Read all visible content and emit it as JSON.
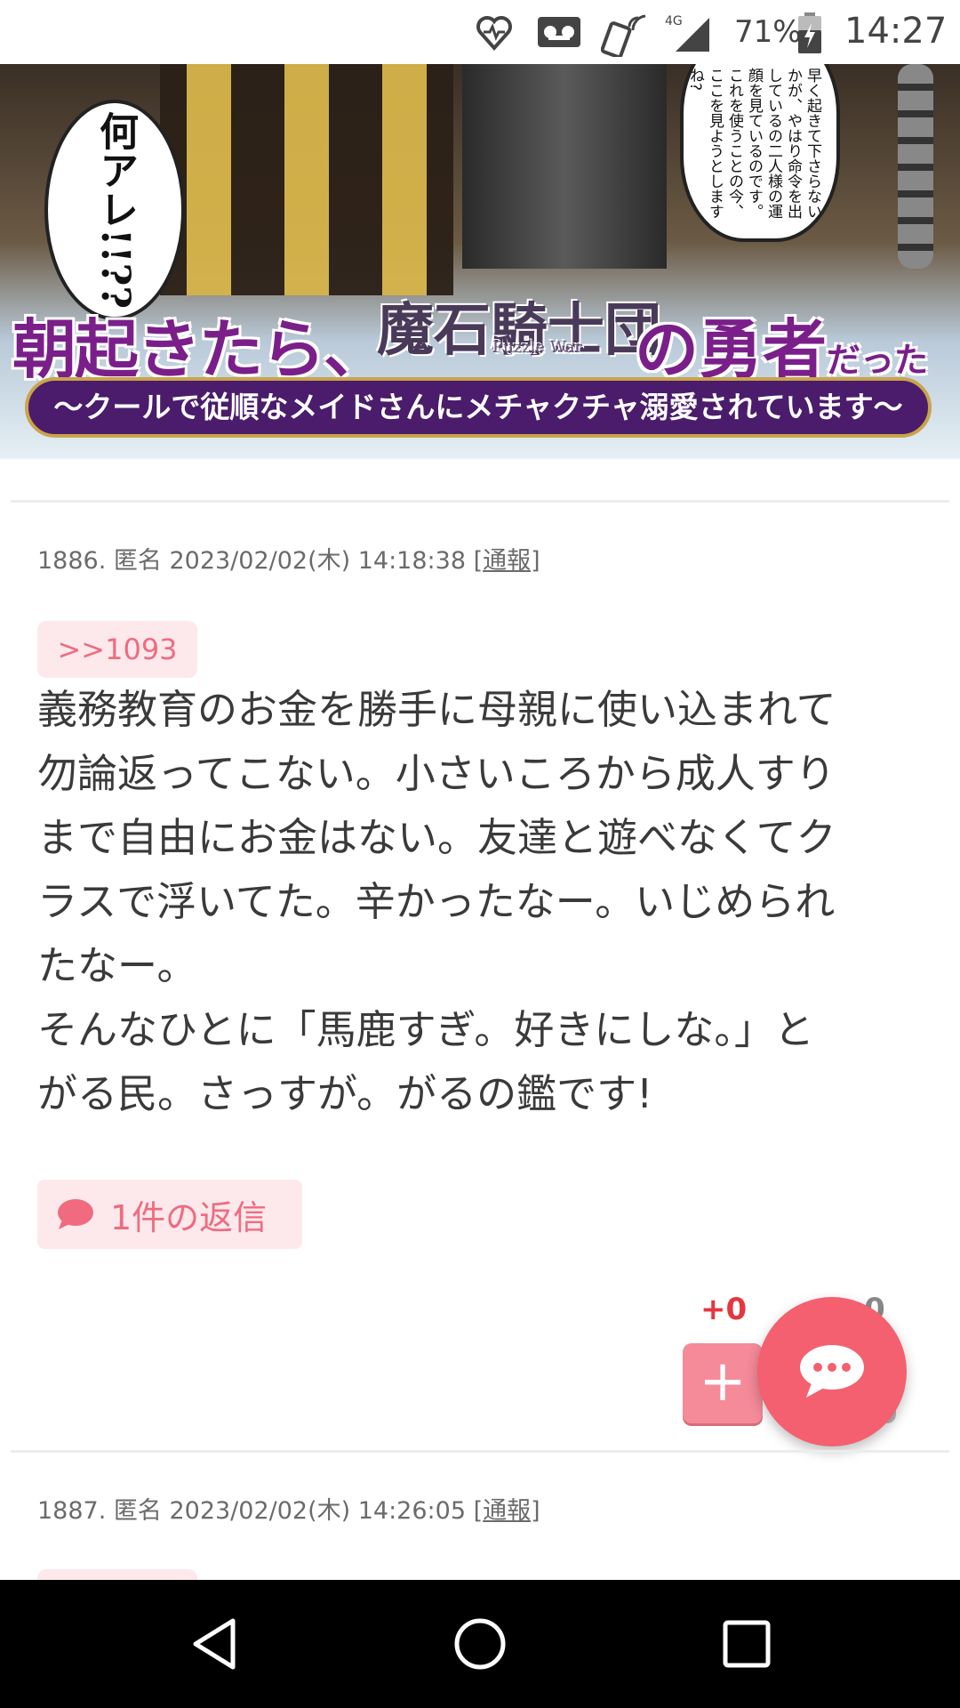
{
  "status_bar": {
    "battery": "71%",
    "time": "14:27",
    "network": "4G",
    "icons": [
      "heart-monitor-icon",
      "voicemail-icon",
      "nfc-icon",
      "signal-icon",
      "battery-charging-icon"
    ]
  },
  "banner": {
    "bubble_left": "何アレ!!??",
    "bubble_right": "早く起きて下さらないかが、やはり命令を出しているの二人様の運顔を見ているのです。これを使うことの今、ここを見ようとしますね?",
    "title_left": "朝起きたら、",
    "logo": "魔石騎士団",
    "logo_sub": "Puzzle War",
    "title_right_main": "の勇者",
    "title_right_small": "だった",
    "subtitle": "〜クールで従順なメイドさんにメチャクチャ溺愛されています〜"
  },
  "post": {
    "meta_prefix": "1886. 匿名 2023/02/02(木) 14:18:38 [",
    "report": "通報",
    "meta_suffix": "]",
    "anchor": ">>1093",
    "body": "義務教育のお金を勝手に母親に使い込まれて\n勿論返ってこない。小さいころから成人すり\nまで自由にお金はない。友達と遊べなくてク\nラスで浮いてた。辛かったなー。いじめられ\nたなー。\nそんなひとに「馬鹿すぎ。好きにしな。」と\nがる民。さっすが。がるの鑑です!",
    "reply_label": "1件の返信",
    "plus_votes": "+0",
    "minus_votes": "-0",
    "plus_symbol": "+"
  },
  "next_post": {
    "meta_prefix": "1887. 匿名 2023/02/02(木) 14:26:05 [",
    "report": "通報",
    "meta_suffix": "]"
  },
  "colors": {
    "accent": "#f4606f",
    "pill_bg": "#fde9ec",
    "pill_text": "#f06b7f",
    "plus_count": "#e6363f"
  }
}
